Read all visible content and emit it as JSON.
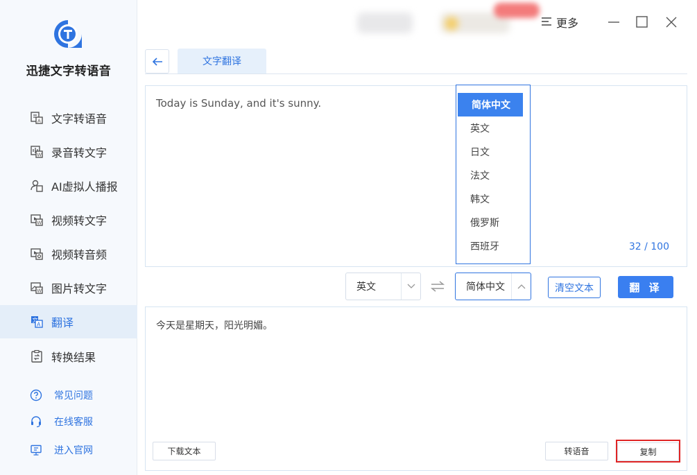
{
  "app": {
    "title": "迅捷文字转语音",
    "brand_color": "#2f74e0"
  },
  "sidebar": {
    "items": [
      {
        "label": "文字转语音",
        "icon": "text-to-speech-icon"
      },
      {
        "label": "录音转文字",
        "icon": "audio-to-text-icon"
      },
      {
        "label": "AI虚拟人播报",
        "icon": "ai-avatar-icon"
      },
      {
        "label": "视频转文字",
        "icon": "video-to-text-icon"
      },
      {
        "label": "视频转音频",
        "icon": "video-to-audio-icon"
      },
      {
        "label": "图片转文字",
        "icon": "image-to-text-icon"
      },
      {
        "label": "翻译",
        "icon": "translate-icon",
        "active": true
      },
      {
        "label": "转换结果",
        "icon": "results-icon"
      }
    ],
    "help": [
      {
        "label": "常见问题",
        "icon": "question-icon"
      },
      {
        "label": "在线客服",
        "icon": "headset-icon"
      },
      {
        "label": "进入官网",
        "icon": "monitor-icon"
      }
    ]
  },
  "topbar": {
    "more_label": "更多"
  },
  "tab": {
    "label": "文字翻译"
  },
  "source": {
    "text": "Today is Sunday, and it's sunny.",
    "char_count": "32 / 100"
  },
  "dropdown": {
    "options": [
      "简体中文",
      "英文",
      "日文",
      "法文",
      "韩文",
      "俄罗斯",
      "西班牙"
    ],
    "selected": "简体中文"
  },
  "controls": {
    "source_lang": "英文",
    "target_lang": "简体中文",
    "clear_label": "清空文本",
    "translate_label": "翻 译"
  },
  "target": {
    "text": "今天是星期天，阳光明媚。",
    "download_label": "下载文本",
    "to_speech_label": "转语音",
    "copy_label": "复制"
  }
}
